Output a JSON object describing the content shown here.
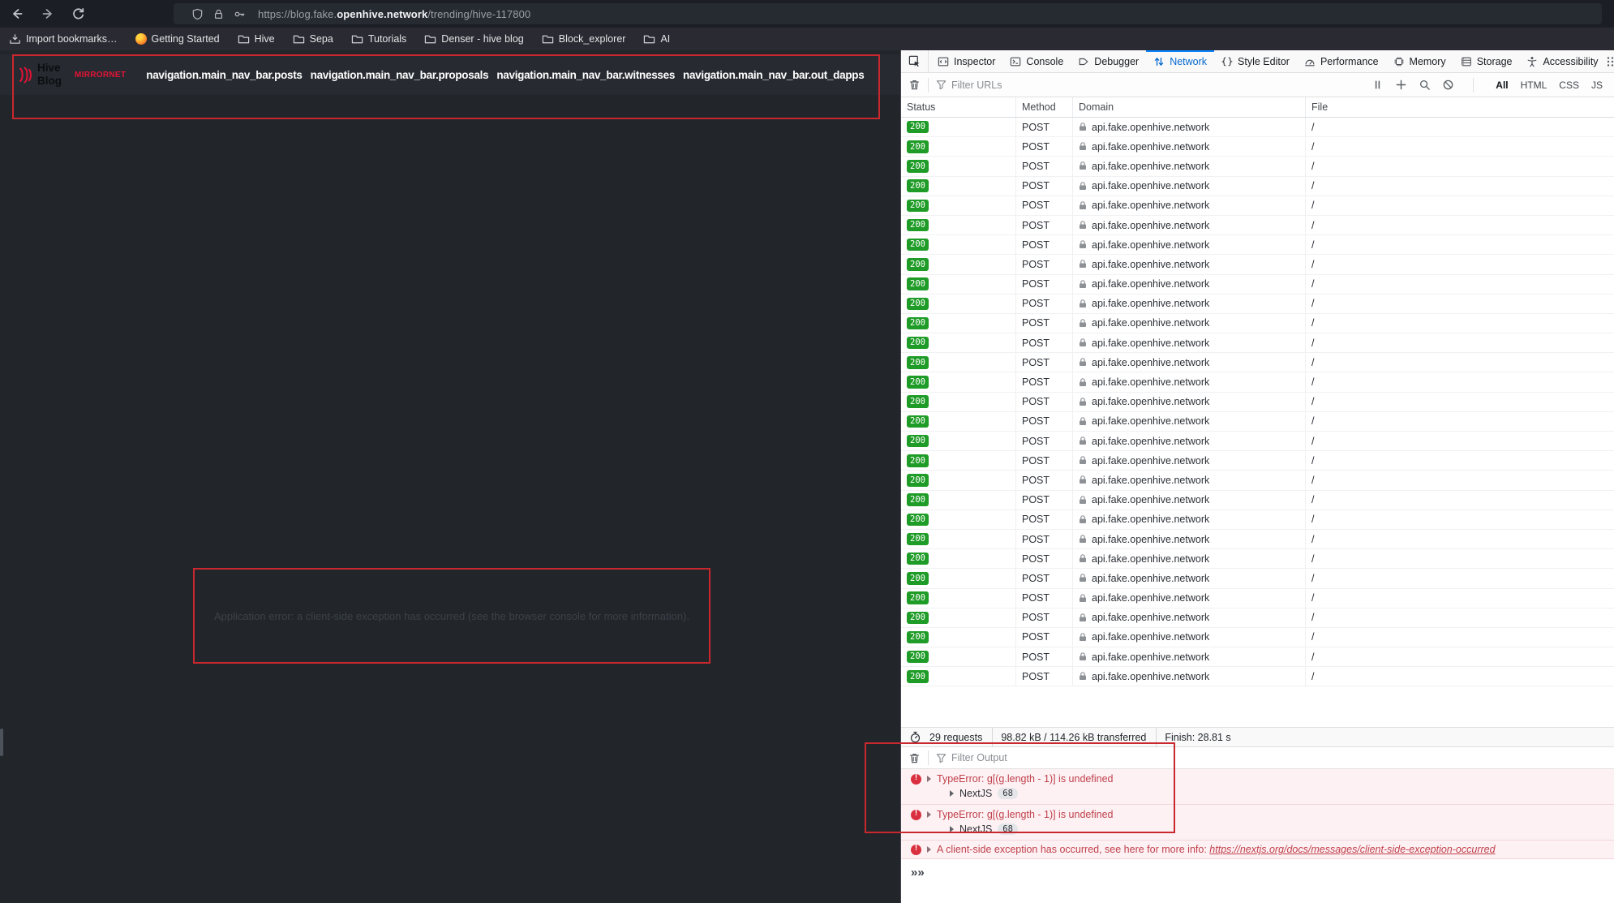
{
  "browser": {
    "url": {
      "prefix": "https://blog.fake.",
      "domain": "openhive.network",
      "path": "/trending/hive-117800"
    },
    "bookmarks": [
      {
        "label": "Import bookmarks…",
        "icon": "import-icon"
      },
      {
        "label": "Getting Started",
        "icon": "firefox-icon"
      },
      {
        "label": "Hive",
        "icon": "folder-icon"
      },
      {
        "label": "Sepa",
        "icon": "folder-icon"
      },
      {
        "label": "Tutorials",
        "icon": "folder-icon"
      },
      {
        "label": "Denser - hive blog",
        "icon": "folder-icon"
      },
      {
        "label": "Block_explorer",
        "icon": "folder-icon"
      },
      {
        "label": "AI",
        "icon": "folder-icon"
      }
    ]
  },
  "page": {
    "brand_line1": "Hive",
    "brand_line2": "Blog",
    "network_badge": "MIRRORNET",
    "nav_items": [
      "navigation.main_nav_bar.posts",
      "navigation.main_nav_bar.proposals",
      "navigation.main_nav_bar.witnesses",
      "navigation.main_nav_bar.out_dapps"
    ],
    "error_message": "Application error: a client-side exception has occurred (see the browser console for more information)."
  },
  "devtools": {
    "tabs": [
      {
        "label": "Inspector",
        "icon": "inspector-icon"
      },
      {
        "label": "Console",
        "icon": "console-icon"
      },
      {
        "label": "Debugger",
        "icon": "debugger-icon"
      },
      {
        "label": "Network",
        "icon": "network-icon",
        "active": true
      },
      {
        "label": "Style Editor",
        "icon": "style-editor-icon"
      },
      {
        "label": "Performance",
        "icon": "performance-icon"
      },
      {
        "label": "Memory",
        "icon": "memory-icon"
      },
      {
        "label": "Storage",
        "icon": "storage-icon"
      },
      {
        "label": "Accessibility",
        "icon": "accessibility-icon"
      }
    ],
    "network": {
      "filter_placeholder": "Filter URLs",
      "type_filters": [
        "All",
        "HTML",
        "CSS",
        "JS"
      ],
      "active_type_filter": "All",
      "columns": {
        "status": "Status",
        "method": "Method",
        "domain": "Domain",
        "file": "File"
      },
      "request_count": 29,
      "request_row": {
        "status": "200",
        "method": "POST",
        "domain": "api.fake.openhive.network",
        "file": "/"
      },
      "summary": {
        "requests": "29 requests",
        "transferred": "98.82 kB / 114.26 kB transferred",
        "finish": "Finish: 28.81 s"
      }
    },
    "console": {
      "filter_placeholder": "Filter Output",
      "errors": [
        {
          "message": "TypeError: g[(g.length - 1)] is undefined",
          "source": "NextJS",
          "count": "68"
        },
        {
          "message": "TypeError: g[(g.length - 1)] is undefined",
          "source": "NextJS",
          "count": "68"
        },
        {
          "message": "A client-side exception has occurred, see here for more info: ",
          "link": "https://nextjs.org/docs/messages/client-side-exception-occurred"
        }
      ],
      "prompt": "»"
    }
  },
  "colors": {
    "accent_red": "#c9282e",
    "hive_red": "#e31337",
    "badge_green": "#1f9c27",
    "tab_active_blue": "#0669cc",
    "tab_line_blue": "#0a84ff",
    "error_bg": "#fdf1f4",
    "error_text": "#c0404a"
  }
}
